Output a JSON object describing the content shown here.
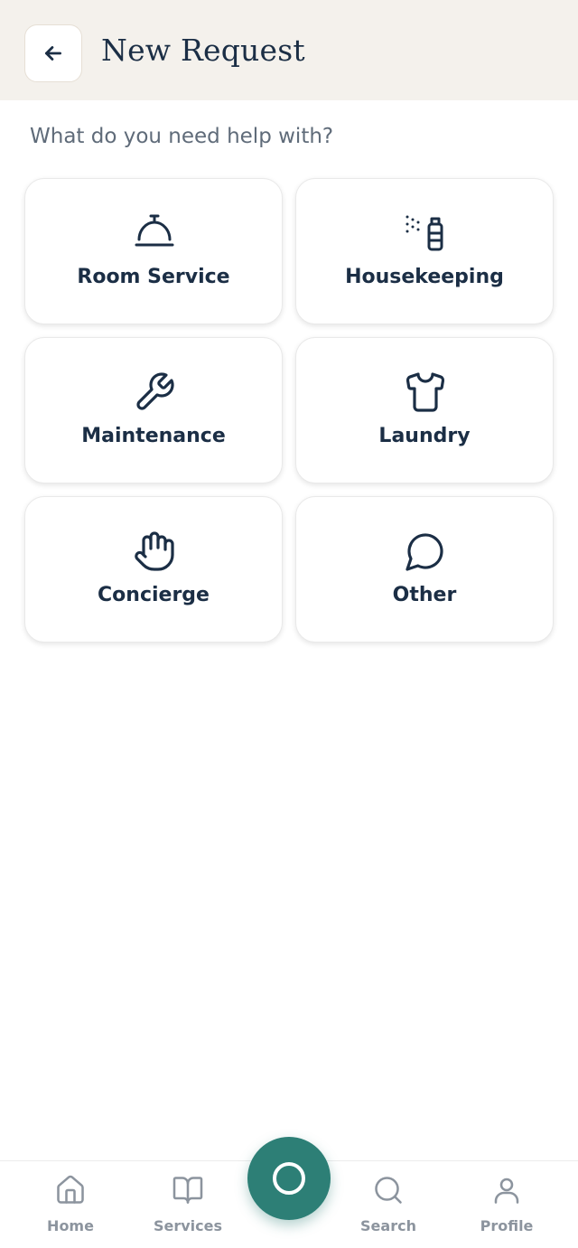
{
  "header": {
    "title": "New Request",
    "back_icon": "arrow-left-icon"
  },
  "prompt": "What do you need help with?",
  "categories": [
    {
      "label": "Room Service",
      "icon": "service-bell-icon"
    },
    {
      "label": "Housekeeping",
      "icon": "spray-bottle-icon"
    },
    {
      "label": "Maintenance",
      "icon": "wrench-icon"
    },
    {
      "label": "Laundry",
      "icon": "shirt-icon"
    },
    {
      "label": "Concierge",
      "icon": "hand-icon"
    },
    {
      "label": "Other",
      "icon": "chat-bubble-icon"
    }
  ],
  "bottom_nav": {
    "items": [
      {
        "label": "Home",
        "icon": "home-icon"
      },
      {
        "label": "Services",
        "icon": "book-icon"
      },
      {
        "label": "Search",
        "icon": "search-icon"
      },
      {
        "label": "Profile",
        "icon": "user-icon"
      }
    ],
    "fab_icon": "circle-icon"
  },
  "colors": {
    "primary": "#1b2e45",
    "accent": "#2d7f76",
    "header_bg": "#f4f1ec",
    "muted": "#8c949e"
  }
}
